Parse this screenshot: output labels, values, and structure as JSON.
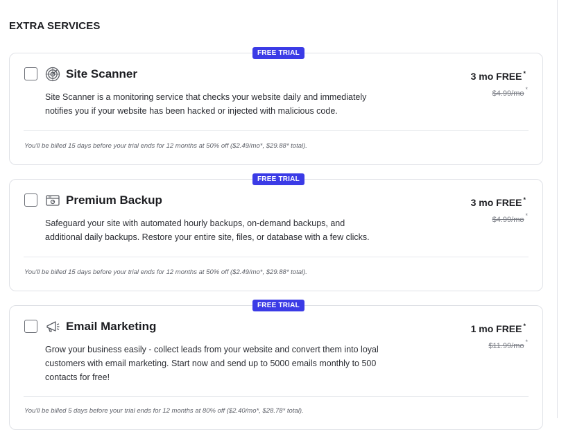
{
  "section": {
    "title": "EXTRA SERVICES"
  },
  "colors": {
    "badge": "#3b3be6",
    "text": "#1c1d21",
    "muted": "#7a7d85",
    "border": "#dfe1e6"
  },
  "services": [
    {
      "badge": "FREE TRIAL",
      "icon": "radar-icon",
      "name": "Site Scanner",
      "price": "3 mo FREE",
      "price_mark": "*",
      "old_price": "$4.99/mo",
      "old_price_mark": "*",
      "description": "Site Scanner is a monitoring service that checks your website daily and immediately notifies you if your website has been hacked or injected with malicious code.",
      "billing": "You'll be billed 15 days before your trial ends for 12 months at 50% off ($2.49/mo*, $29.88* total)."
    },
    {
      "badge": "FREE TRIAL",
      "icon": "backup-icon",
      "name": "Premium Backup",
      "price": "3 mo FREE",
      "price_mark": "*",
      "old_price": "$4.99/mo",
      "old_price_mark": "*",
      "description": "Safeguard your site with automated hourly backups, on-demand backups, and additional daily backups. Restore your entire site, files, or database with a few clicks.",
      "billing": "You'll be billed 15 days before your trial ends for 12 months at 50% off ($2.49/mo*, $29.88* total)."
    },
    {
      "badge": "FREE TRIAL",
      "icon": "megaphone-icon",
      "name": "Email Marketing",
      "price": "1 mo FREE",
      "price_mark": "*",
      "old_price": "$11.99/mo",
      "old_price_mark": "*",
      "description": "Grow your business easily - collect leads from your website and convert them into loyal customers with email marketing. Start now and send up to 5000 emails monthly to 500 contacts for free!",
      "billing": "You'll be billed 5 days before your trial ends for 12 months at 80% off ($2.40/mo*, $28.78* total)."
    }
  ]
}
